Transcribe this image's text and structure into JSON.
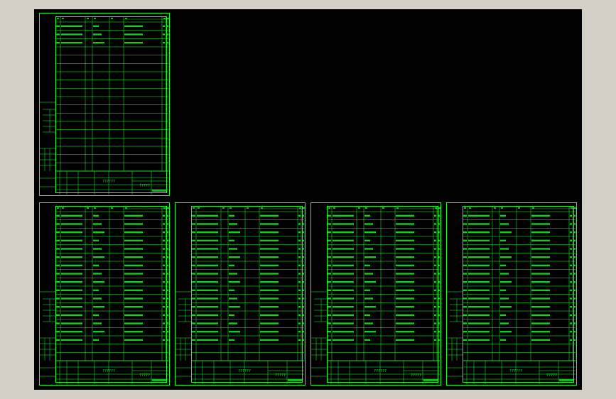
{
  "drawing": {
    "sheets": [
      {
        "id": "sheet-1",
        "filled_rows": 3,
        "stamp_code": "??????",
        "stamp_title": "?????"
      },
      {
        "id": "sheet-2",
        "filled_rows": 16,
        "stamp_code": "??????",
        "stamp_title": "?????"
      },
      {
        "id": "sheet-3",
        "filled_rows": 16,
        "stamp_code": "??????",
        "stamp_title": "?????"
      },
      {
        "id": "sheet-4",
        "filled_rows": 16,
        "stamp_code": "??????",
        "stamp_title": "?????"
      },
      {
        "id": "sheet-5",
        "filled_rows": 16,
        "stamp_code": "??????",
        "stamp_title": "?????"
      }
    ],
    "colors": {
      "background": "#000000",
      "line": "#19ff2a",
      "frame": "#d4d0c8"
    }
  }
}
